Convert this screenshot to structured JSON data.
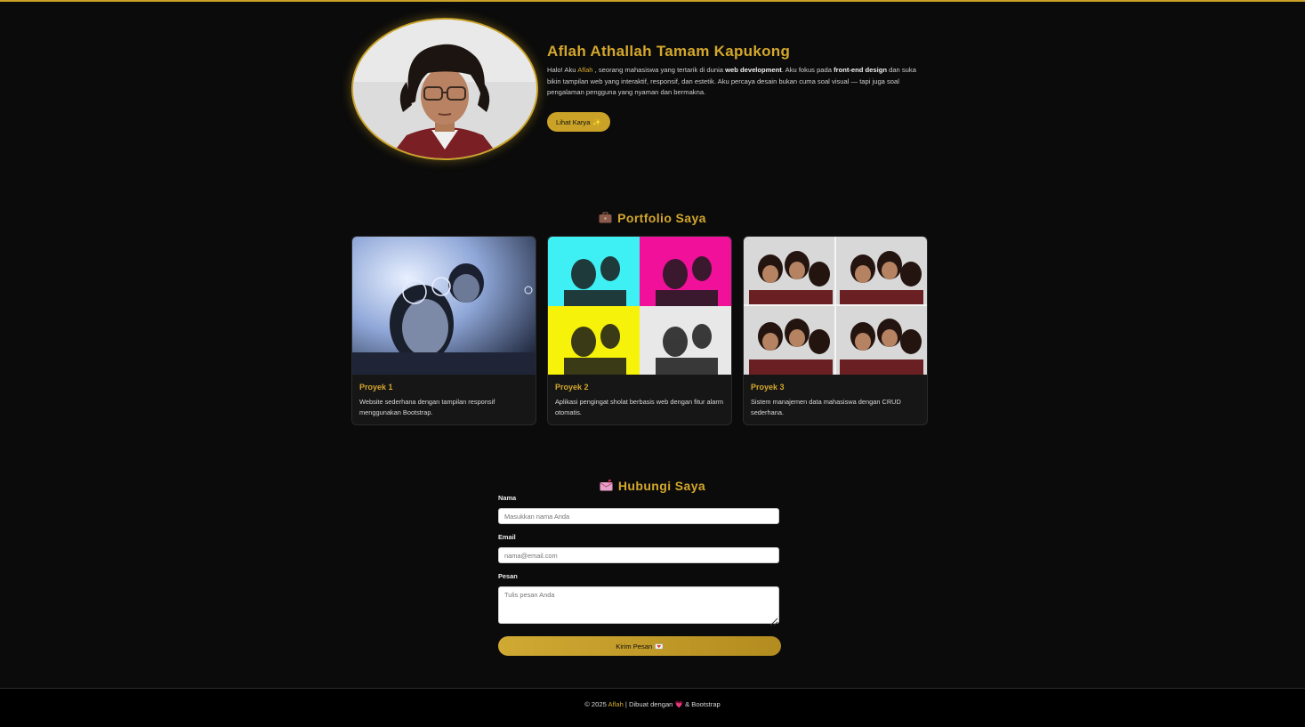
{
  "hero": {
    "name": "Aflah Athallah Tamam Kapukong",
    "bio_1": "Halo! Aku ",
    "bio_name": "Aflah",
    "bio_2": " , seorang mahasiswa yang tertarik di dunia ",
    "bio_bold_1": "web development",
    "bio_3": ". Aku fokus pada ",
    "bio_bold_2": "front-end design",
    "bio_4": " dan suka bikin tampilan web yang interaktif, responsif, dan estetik. Aku percaya desain bukan cuma soal visual — tapi juga soal pengalaman pengguna yang nyaman dan bermakna.",
    "button_label": "Lihat Karya",
    "button_emoji": "✨"
  },
  "portfolio": {
    "icon": "briefcase-icon",
    "title": "Portfolio Saya",
    "cards": [
      {
        "title": "Proyek 1",
        "desc": "Website sederhana dengan tampilan responsif menggunakan Bootstrap."
      },
      {
        "title": "Proyek 2",
        "desc": "Aplikasi pengingat sholat berbasis web dengan fitur alarm otomatis."
      },
      {
        "title": "Proyek 3",
        "desc": "Sistem manajemen data mahasiswa dengan CRUD sederhana."
      }
    ]
  },
  "contact": {
    "icon": "mailbox-icon",
    "title": "Hubungi Saya",
    "name_label": "Nama",
    "name_placeholder": "Masukkan nama Anda",
    "email_label": "Email",
    "email_placeholder": "nama@email.com",
    "message_label": "Pesan",
    "message_placeholder": "Tulis pesan Anda",
    "submit_label": "Kirim Pesan",
    "submit_emoji": "💌"
  },
  "footer": {
    "prefix": "© 2025 ",
    "name": "Aflah",
    "middle": " | Dibuat dengan ",
    "heart": "💗",
    "suffix": " & Bootstrap"
  },
  "colors": {
    "accent": "#d4a72c",
    "background": "#0b0b0b",
    "card": "#161616"
  }
}
